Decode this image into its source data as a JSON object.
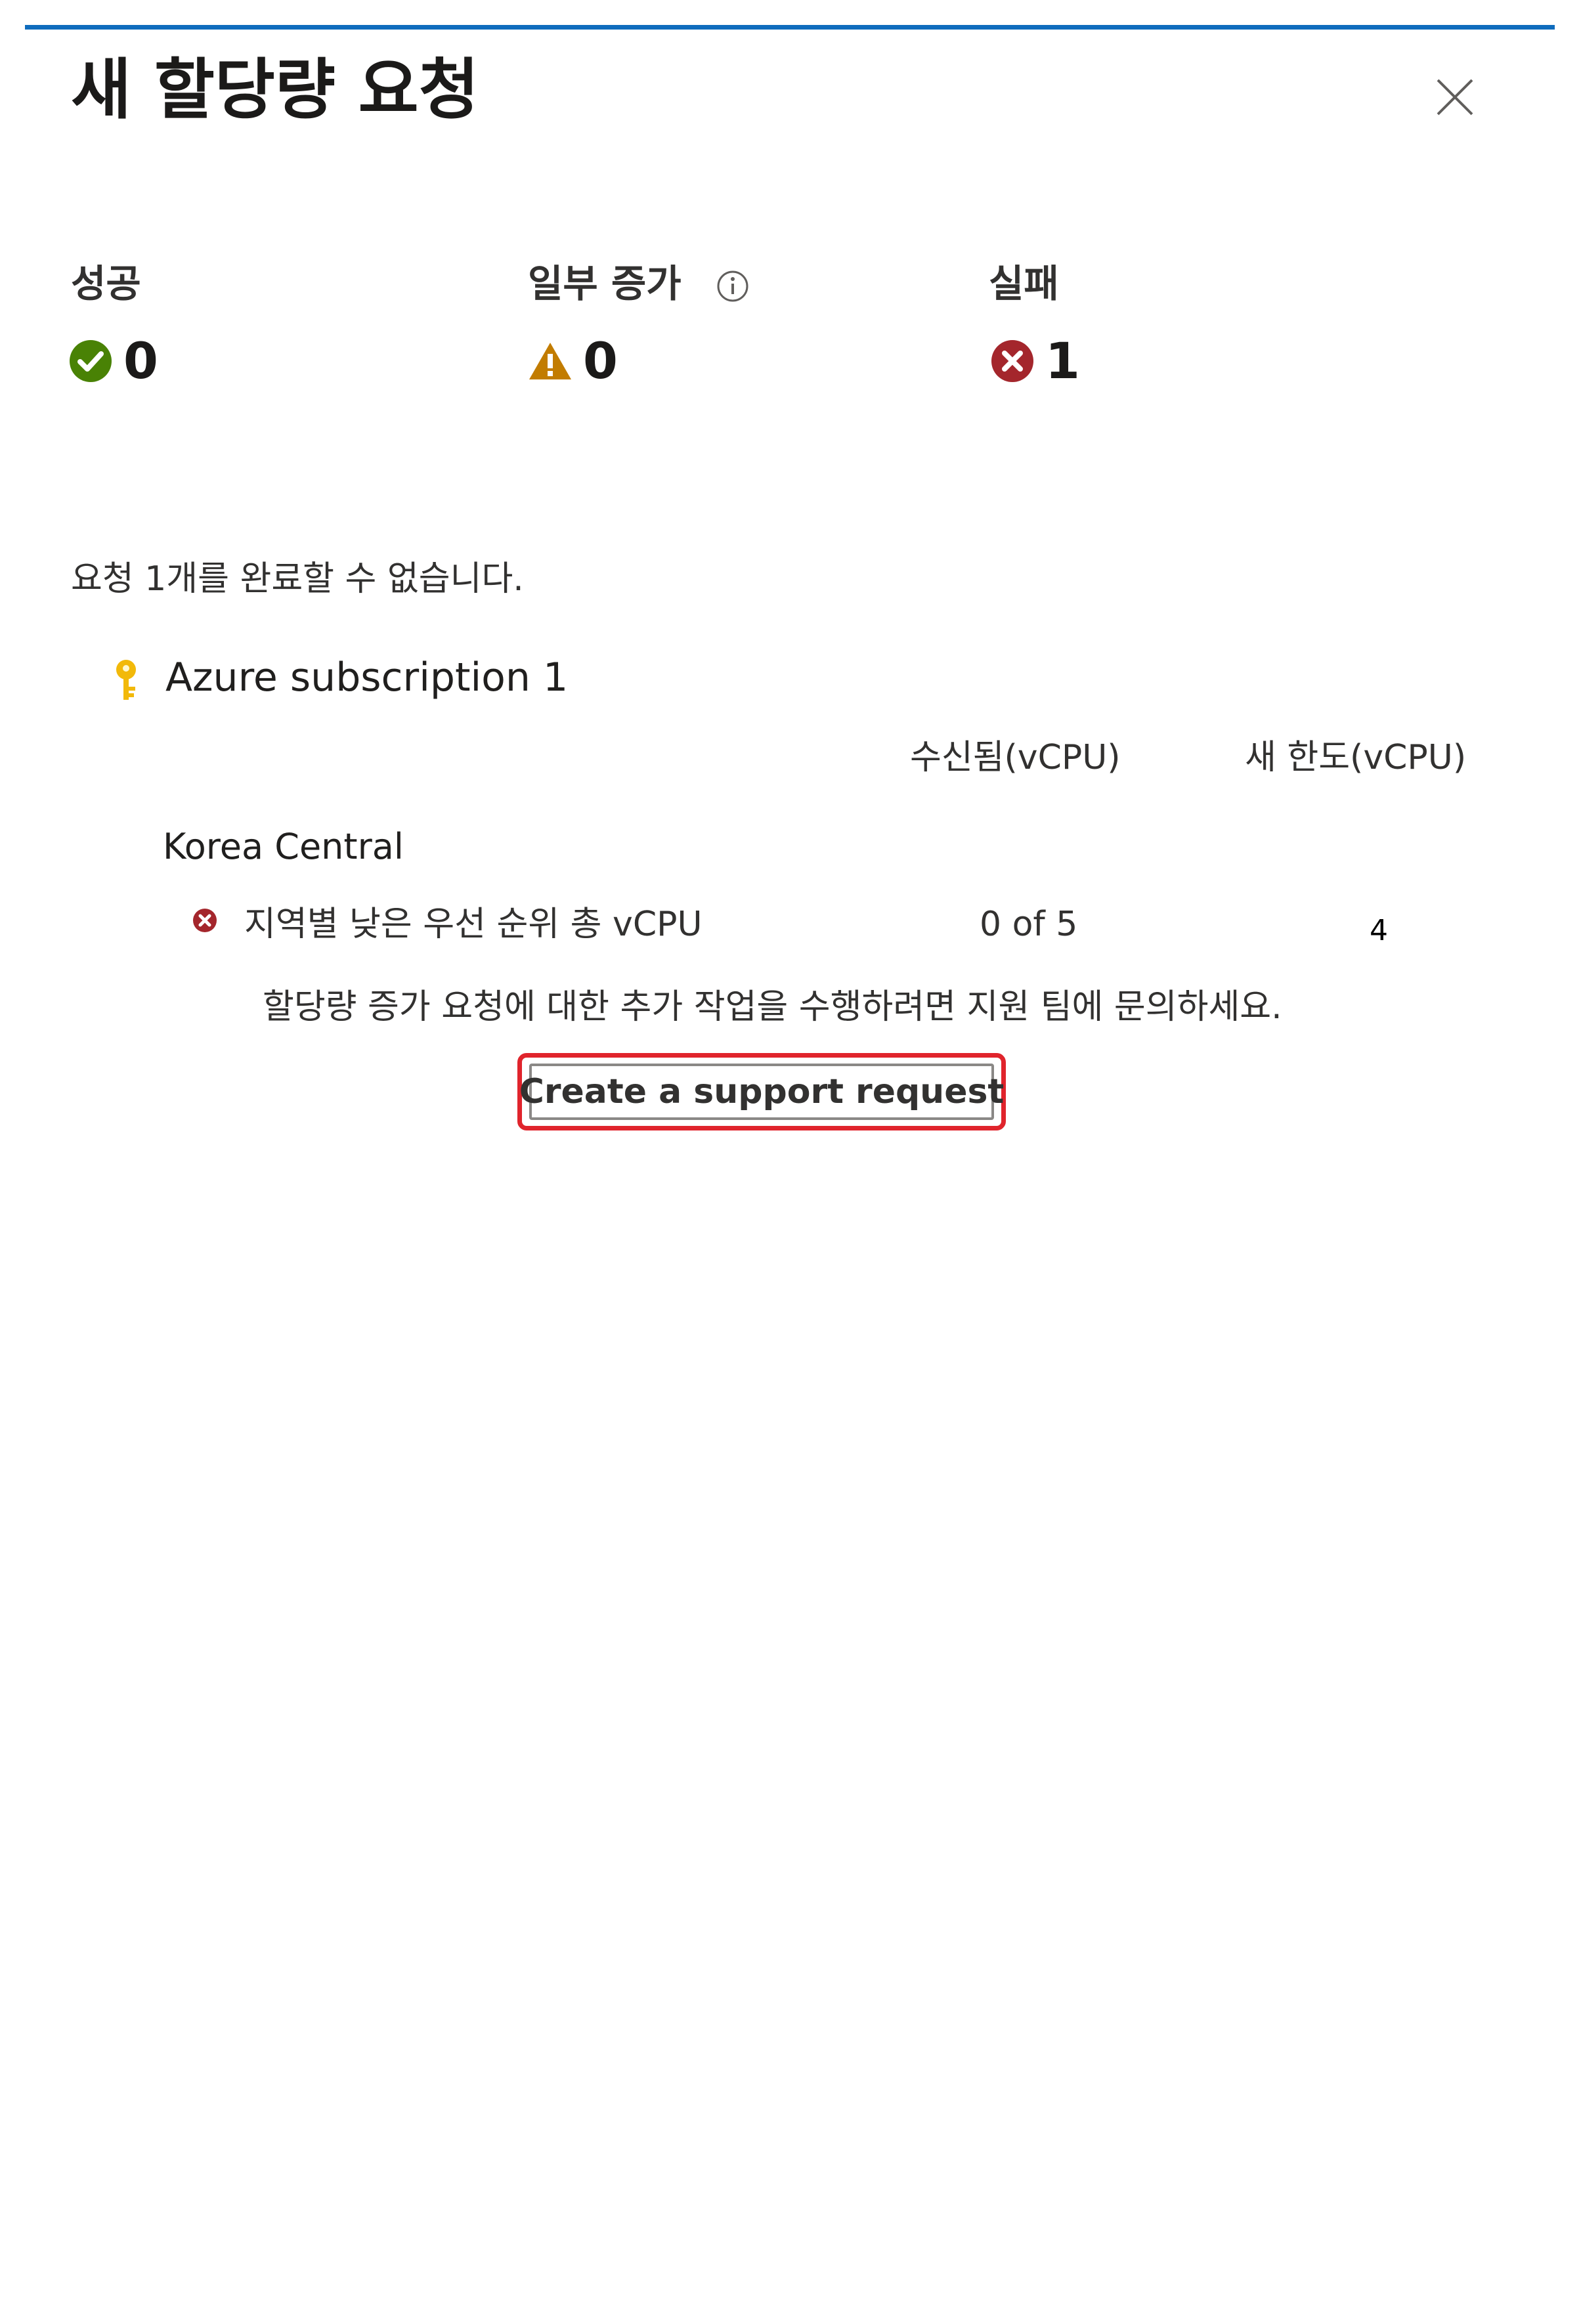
{
  "panel": {
    "title": "새 할당량 요청"
  },
  "stats": {
    "success": {
      "label": "성공",
      "value": "0"
    },
    "partial": {
      "label": "일부 증가",
      "value": "0"
    },
    "failed": {
      "label": "실패",
      "value": "1"
    }
  },
  "summary": "요청 1개를 완료할 수 없습니다.",
  "subscription": {
    "name": "Azure subscription 1",
    "columns": {
      "received": "수신됨(vCPU)",
      "new_limit": "새 한도(vCPU)"
    },
    "region": "Korea Central",
    "row": {
      "label": "지역별 낮은 우선 순위 총 vCPU",
      "received": "0 of 5",
      "new_limit": "4"
    }
  },
  "contact_text": "할당량 증가 요청에 대한 추가 작업을 수행하려면 지원 팀에 문의하세요.",
  "support_button": "Create a support request",
  "colors": {
    "accent": "#0f6cbd",
    "success": "#498205",
    "warning": "#c27c00",
    "error": "#a4262c",
    "highlight": "#e0242c"
  },
  "icons": {
    "close": "close-icon",
    "info": "info-icon",
    "success": "success-check-icon",
    "warning": "warning-triangle-icon",
    "error": "error-x-icon",
    "subscription": "key-icon"
  }
}
